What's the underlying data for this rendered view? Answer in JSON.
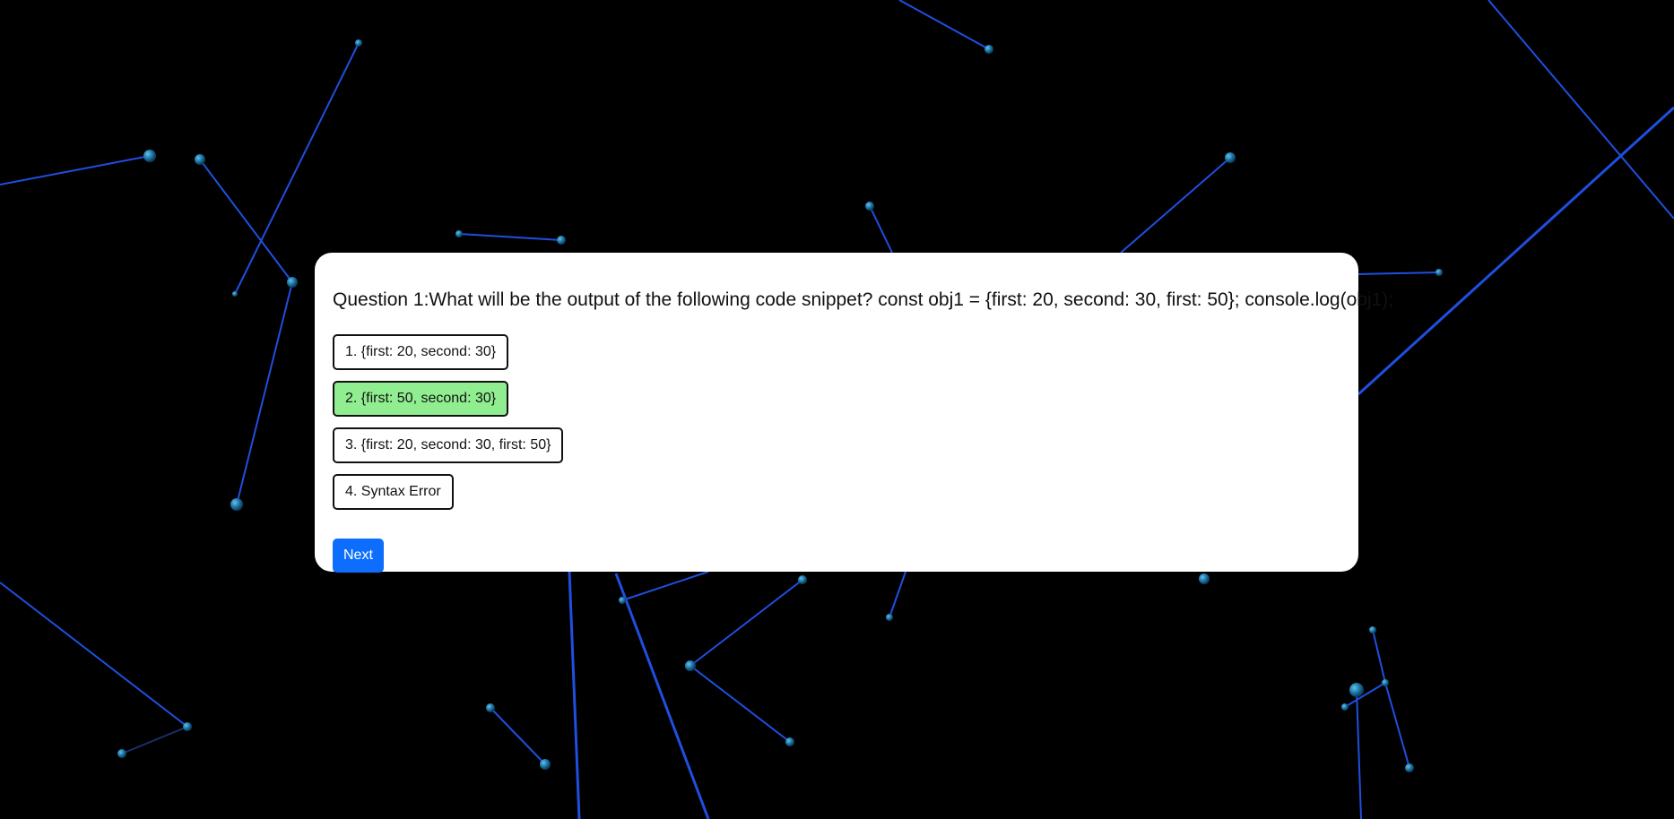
{
  "quiz": {
    "question": "Question 1:What will be the output of the following code snippet? const obj1 = {first: 20, second: 30, first: 50}; console.log(obj1);",
    "options": [
      {
        "label": "1. {first: 20, second: 30}",
        "selected": false
      },
      {
        "label": "2. {first: 50, second: 30}",
        "selected": true
      },
      {
        "label": "3. {first: 20, second: 30, first: 50}",
        "selected": false
      },
      {
        "label": "4. Syntax Error",
        "selected": false
      }
    ],
    "next_label": "Next"
  },
  "colors": {
    "background": "#000000",
    "line": "#1f4fe0",
    "node": "#1a7fb0",
    "selected_option": "#90ee90",
    "button": "#0d6efd"
  }
}
